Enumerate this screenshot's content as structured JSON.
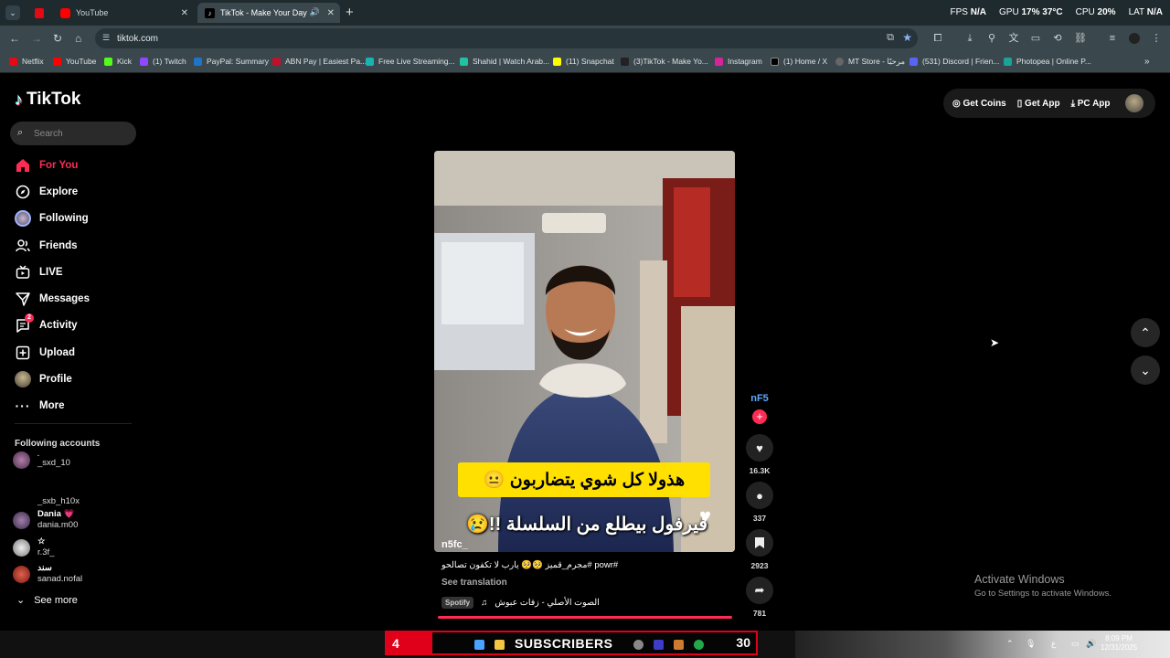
{
  "browser": {
    "tabs": [
      {
        "label": "",
        "active": false
      },
      {
        "label": "YouTube",
        "active": false
      },
      {
        "label": "TikTok - Make Your Day",
        "active": true
      }
    ],
    "url": "tiktok.com",
    "perf": {
      "fps_label": "FPS",
      "fps": "N/A",
      "gpu_label": "GPU",
      "gpu": "17",
      "gpu_unit": "%",
      "gpu_temp": "37",
      "gpu_temp_unit": "°C",
      "cpu_label": "CPU",
      "cpu": "20",
      "cpu_unit": "%",
      "lat_label": "LAT",
      "lat": "N/A"
    },
    "bookmarks": [
      {
        "label": "Netflix",
        "color": "#e50914"
      },
      {
        "label": "YouTube",
        "color": "#ff0000"
      },
      {
        "label": "Kick",
        "color": "#53fc18"
      },
      {
        "label": "(1) Twitch",
        "color": "#9146ff"
      },
      {
        "label": "PayPal: Summary",
        "color": "#1f74c8"
      },
      {
        "label": "ABN Pay | Easiest Pa...",
        "color": "#c0102a"
      },
      {
        "label": "Free Live Streaming...",
        "color": "#18b3b3"
      },
      {
        "label": "Shahid | Watch Arab...",
        "color": "#22c1a4"
      },
      {
        "label": "(11) Snapchat",
        "color": "#fffc00"
      },
      {
        "label": "(3)TikTok - Make Yo...",
        "color": "#222222"
      },
      {
        "label": "Instagram",
        "color": "#d6249f"
      },
      {
        "label": "(1) Home / X",
        "color": "#000000"
      },
      {
        "label": "MT Store - مرحبًا",
        "color": "#666666"
      },
      {
        "label": "(531) Discord | Frien...",
        "color": "#5865f2"
      },
      {
        "label": "Photopea | Online P...",
        "color": "#18a497"
      }
    ]
  },
  "sidebar": {
    "logo": "TikTok",
    "search_placeholder": "Search",
    "nav": [
      {
        "label": "For You",
        "icon": "home-icon",
        "active": true
      },
      {
        "label": "Explore",
        "icon": "compass-icon",
        "active": false
      },
      {
        "label": "Following",
        "icon": "following-avatar-icon",
        "active": false
      },
      {
        "label": "Friends",
        "icon": "friends-icon",
        "active": false
      },
      {
        "label": "LIVE",
        "icon": "live-icon",
        "active": false
      },
      {
        "label": "Messages",
        "icon": "messages-icon",
        "active": false
      },
      {
        "label": "Activity",
        "icon": "activity-icon",
        "active": false,
        "badge": "2"
      },
      {
        "label": "Upload",
        "icon": "upload-icon",
        "active": false
      },
      {
        "label": "Profile",
        "icon": "profile-icon",
        "active": false
      },
      {
        "label": "More",
        "icon": "more-icon",
        "active": false
      }
    ],
    "following_title": "Following accounts",
    "accounts": [
      {
        "name": ".",
        "username": "_sxd_10",
        "avatar_color": "#6a4a6a"
      },
      {
        "name": "",
        "username": "_sxb_h10x",
        "avatar_color": ""
      },
      {
        "name": "Dania 💗",
        "username": "dania.m00",
        "avatar_color": "#7a5a7a"
      },
      {
        "name": "☆",
        "username": "r.3f_",
        "avatar_color": "#bbbbbb"
      },
      {
        "name": "سند",
        "username": "sanad.nofal",
        "avatar_color": "#c0392b"
      }
    ],
    "see_more": "See more"
  },
  "topbar": {
    "get_coins": "Get Coins",
    "get_app": "Get App",
    "pc_app": "PC App"
  },
  "video": {
    "caption_line1": "هذولا كل شوي يتضاربون 😐",
    "caption_line2": "فيرفول بيطلع من السلسلة !!😢",
    "overlay_handle": "n5fc_",
    "description": "#powr #مجرم_قميز 🥺🥺 يارب لا تكفون تصالحو",
    "see_translation": "See translation",
    "music_badge": "Spotify",
    "music": "الصوت الأصلي - زفات عبوش",
    "creator_tag": "nF5",
    "likes": "16.3K",
    "comments": "337",
    "saves": "2923",
    "shares": "781"
  },
  "watermark": {
    "line1": "Activate Windows",
    "line2": "Go to Settings to activate Windows."
  },
  "taskbar": {
    "sub_left": "4",
    "sub_text": "SUBSCRIBERS",
    "sub_right": "30",
    "time": "8:09 PM",
    "date": "12/31/2025",
    "tray_lang": "ع"
  }
}
